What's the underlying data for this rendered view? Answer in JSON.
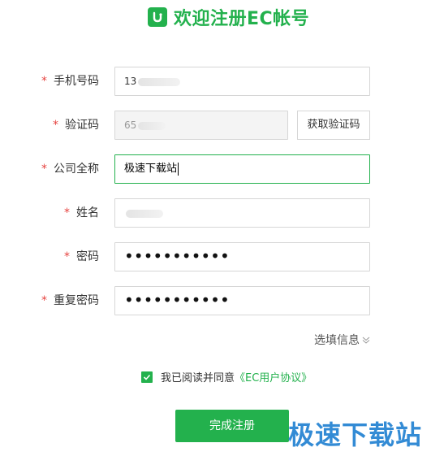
{
  "header": {
    "title": "欢迎注册EC帐号"
  },
  "form": {
    "phone": {
      "label": "手机号码",
      "required": "*",
      "value": "13"
    },
    "code": {
      "label": "验证码",
      "required": "*",
      "value": "65",
      "button": "获取验证码"
    },
    "company": {
      "label": "公司全称",
      "required": "*",
      "value": "极速下载站"
    },
    "name": {
      "label": "姓名",
      "required": "*",
      "value": ""
    },
    "password": {
      "label": "密码",
      "required": "*",
      "value": "•••••••••••"
    },
    "password_repeat": {
      "label": "重复密码",
      "required": "*",
      "value": "•••••••••••"
    },
    "optional_info": "选填信息",
    "agreement": {
      "prefix": "我已阅读并同意",
      "link": "《EC用户协议》",
      "checked": true
    },
    "submit": "完成注册"
  },
  "watermark": "极速下载站",
  "colors": {
    "accent": "#23b14d",
    "required": "#e64340",
    "watermark": "#1d7fd1"
  }
}
